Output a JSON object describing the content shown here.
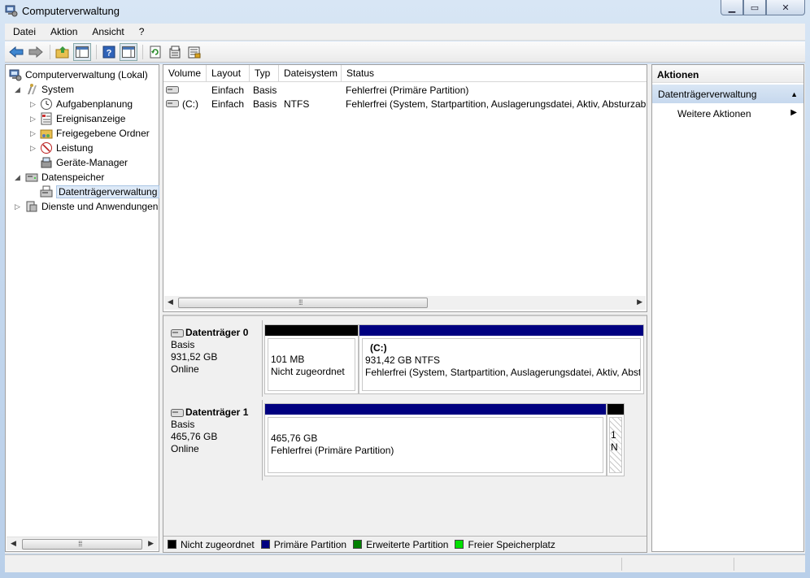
{
  "window": {
    "title": "Computerverwaltung",
    "icon": "computer-management-icon"
  },
  "menu": [
    "Datei",
    "Aktion",
    "Ansicht",
    "?"
  ],
  "toolbar": {
    "icons": [
      "back-arrow-icon",
      "forward-arrow-icon",
      "up-folder-icon",
      "show-tree-icon",
      "help-icon",
      "show-action-pane-icon",
      "refresh-icon",
      "properties-icon",
      "export-icon"
    ]
  },
  "tree": {
    "root": "Computerverwaltung (Lokal)",
    "system": "System",
    "aufgabenplanung": "Aufgabenplanung",
    "ereignisanzeige": "Ereignisanzeige",
    "freigegebene": "Freigegebene Ordner",
    "leistung": "Leistung",
    "geraete": "Geräte-Manager",
    "datenspeicher": "Datenspeicher",
    "datentraeger": "Datenträgerverwaltung",
    "dienste": "Dienste und Anwendungen"
  },
  "volume_list": {
    "columns": [
      "Volume",
      "Layout",
      "Typ",
      "Dateisystem",
      "Status"
    ],
    "rows": [
      {
        "volume": "",
        "layout": "Einfach",
        "typ": "Basis",
        "fs": "",
        "status": "Fehlerfrei (Primäre Partition)"
      },
      {
        "volume": "(C:)",
        "layout": "Einfach",
        "typ": "Basis",
        "fs": "NTFS",
        "status": "Fehlerfrei (System, Startpartition, Auslagerungsdatei, Aktiv, Absturzabb"
      }
    ]
  },
  "disks": [
    {
      "name": "Datenträger 0",
      "type": "Basis",
      "size": "931,52 GB",
      "state": "Online",
      "partitions": [
        {
          "line1": "101 MB",
          "line2": "Nicht zugeordnet",
          "line3": ""
        },
        {
          "line1": "(C:)",
          "line2": "931,42 GB NTFS",
          "line3": "Fehlerfrei (System, Startpartition, Auslagerungsdatei, Aktiv, Abst"
        }
      ]
    },
    {
      "name": "Datenträger 1",
      "type": "Basis",
      "size": "465,76 GB",
      "state": "Online",
      "partitions": [
        {
          "line1": "465,76 GB",
          "line2": "Fehlerfrei (Primäre Partition)"
        },
        {
          "line1": "1",
          "line2": "N"
        }
      ]
    }
  ],
  "legend": [
    {
      "label": "Nicht zugeordnet",
      "color": "#000000"
    },
    {
      "label": "Primäre Partition",
      "color": "#000080"
    },
    {
      "label": "Erweiterte Partition",
      "color": "#008000"
    },
    {
      "label": "Freier Speicherplatz",
      "color": "#00e000"
    }
  ],
  "actions": {
    "header": "Aktionen",
    "section": "Datenträgerverwaltung",
    "more": "Weitere Aktionen"
  }
}
